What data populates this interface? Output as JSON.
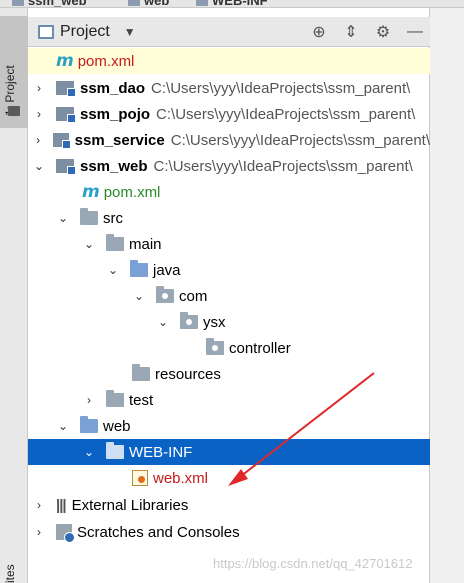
{
  "breadcrumb": [
    "ssm_web",
    "web",
    "WEB-INF"
  ],
  "sidebar": {
    "tab_number": "1",
    "tab_label": ": Project",
    "bottom_label": "ites"
  },
  "header": {
    "title": "Project",
    "icons": [
      "dropdown-icon",
      "locate-icon",
      "collapse-icon",
      "gear-icon",
      "hide-icon"
    ]
  },
  "tree": [
    {
      "label": "pom.xml",
      "icon": "maven-icon",
      "highlight": true
    },
    {
      "label": "ssm_dao",
      "path": "C:\\Users\\yyy\\IdeaProjects\\ssm_parent\\",
      "icon": "module-icon",
      "arrow": "›"
    },
    {
      "label": "ssm_pojo",
      "path": "C:\\Users\\yyy\\IdeaProjects\\ssm_parent\\",
      "icon": "module-icon",
      "arrow": "›"
    },
    {
      "label": "ssm_service",
      "path": "C:\\Users\\yyy\\IdeaProjects\\ssm_parent\\",
      "icon": "module-icon",
      "arrow": "›"
    },
    {
      "label": "ssm_web",
      "path": "C:\\Users\\yyy\\IdeaProjects\\ssm_parent\\",
      "icon": "module-icon",
      "arrow": "⌄"
    },
    {
      "label": "pom.xml",
      "icon": "maven-icon"
    },
    {
      "label": "src",
      "icon": "folder-icon",
      "arrow": "⌄"
    },
    {
      "label": "main",
      "icon": "folder-icon",
      "arrow": "⌄"
    },
    {
      "label": "java",
      "icon": "source-folder-icon",
      "arrow": "⌄"
    },
    {
      "label": "com",
      "icon": "package-icon",
      "arrow": "⌄"
    },
    {
      "label": "ysx",
      "icon": "package-icon",
      "arrow": "⌄"
    },
    {
      "label": "controller",
      "icon": "package-icon"
    },
    {
      "label": "resources",
      "icon": "resources-folder-icon"
    },
    {
      "label": "test",
      "icon": "folder-icon",
      "arrow": "›"
    },
    {
      "label": "web",
      "icon": "web-folder-icon",
      "arrow": "⌄"
    },
    {
      "label": "WEB-INF",
      "icon": "folder-icon",
      "arrow": "⌄",
      "selected": true
    },
    {
      "label": "web.xml",
      "icon": "xml-icon"
    },
    {
      "label": "External Libraries",
      "icon": "libraries-icon",
      "arrow": "›"
    },
    {
      "label": "Scratches and Consoles",
      "icon": "scratches-icon",
      "arrow": "›"
    }
  ],
  "watermark": "https://blog.csdn.net/qq_42701612",
  "colors": {
    "selection": "#0a62c4",
    "highlight_row": "#fffed8",
    "arrow": "#e0282a",
    "maven_text": "#c41b1b",
    "pom_text": "#2a8a2a"
  }
}
